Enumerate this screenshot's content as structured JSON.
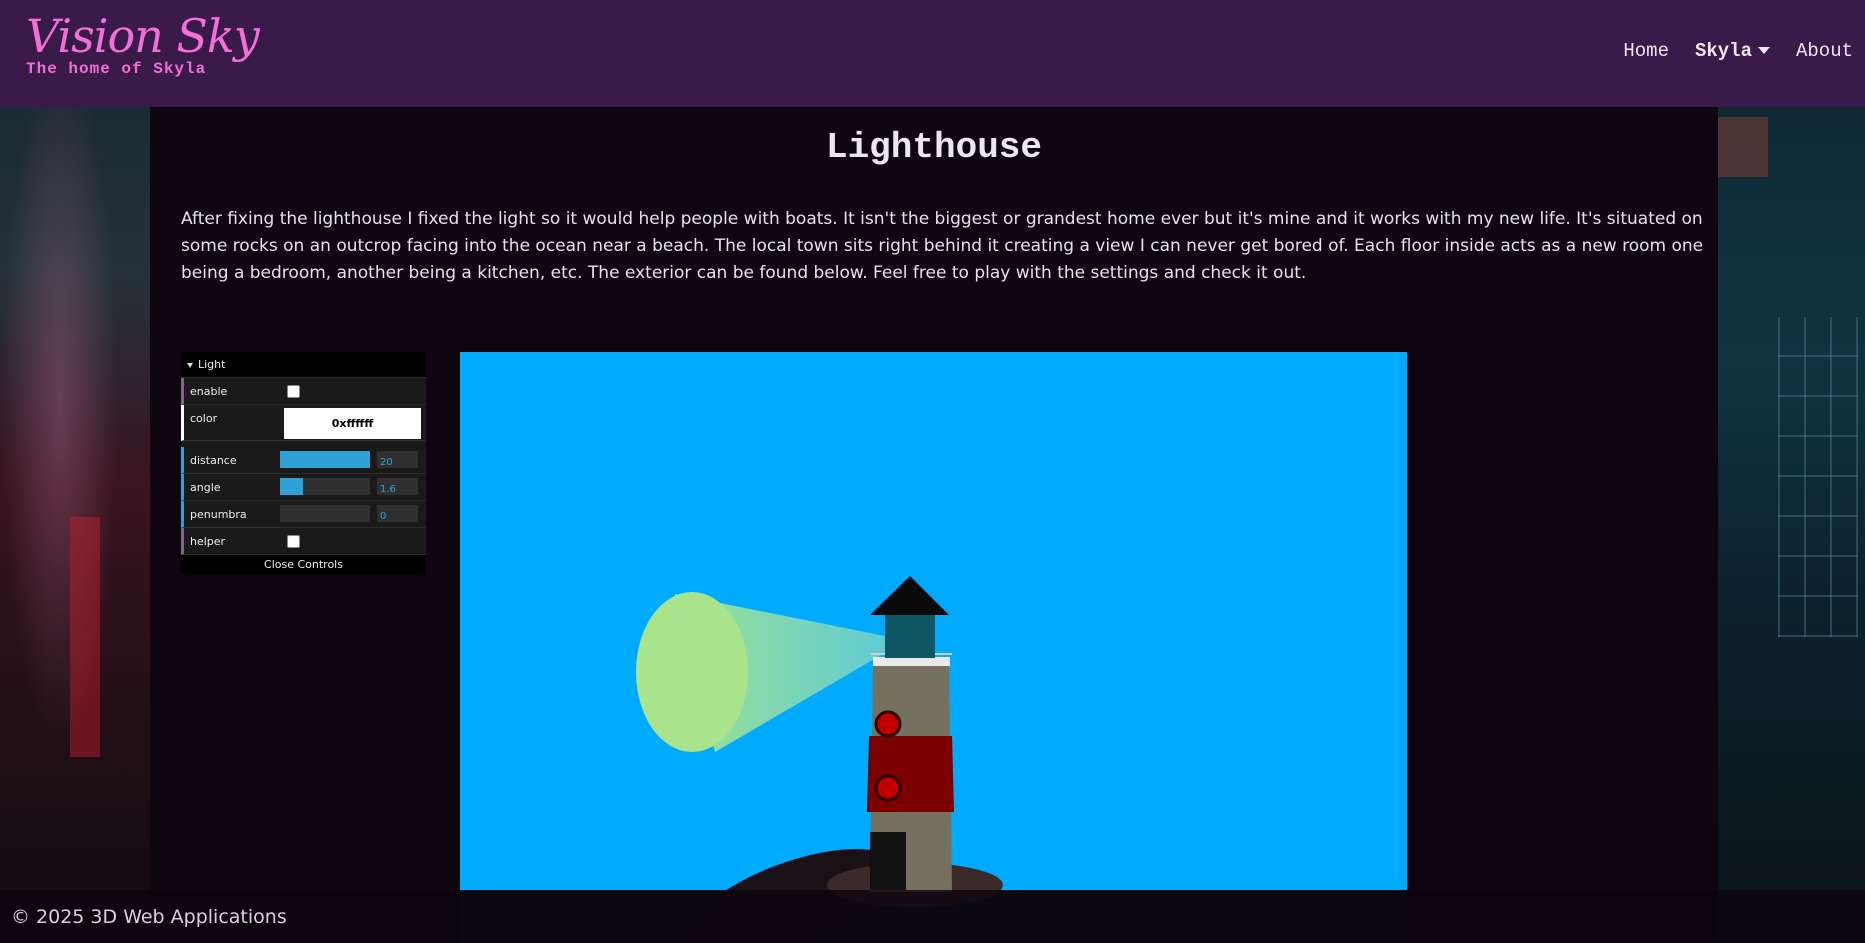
{
  "brand": {
    "title": "Vision Sky",
    "subtitle": "The home of Skyla"
  },
  "nav": {
    "home": "Home",
    "skyla": "Skyla",
    "about": "About"
  },
  "page": {
    "title": "Lighthouse",
    "intro": "After fixing the lighthouse I fixed the light so it would help people with boats. It isn't the biggest or grandest home ever but it's mine and it works with my new life. It's situated on some rocks on an outcrop facing into the ocean near a beach. The local town sits right behind it creating a view I can never get bored of. Each floor inside acts as a new room one being a bedroom, another being a kitchen, etc. The exterior can be found below. Feel free to play with the settings and check it out."
  },
  "gui": {
    "folder": "Light",
    "enable_label": "enable",
    "color_label": "color",
    "color_value": "0xffffff",
    "distance_label": "distance",
    "distance_value": "20",
    "distance_fill": 1.0,
    "angle_label": "angle",
    "angle_value": "1.6",
    "angle_fill": 0.25,
    "penumbra_label": "penumbra",
    "penumbra_value": "0",
    "penumbra_fill": 0.0,
    "helper_label": "helper",
    "close_label": "Close Controls",
    "accent": "#2fa1d6"
  },
  "scene": {
    "sky_color": "#00aaff",
    "ground_color": "#0d1726"
  },
  "footer": {
    "text": "© 2025 3D Web Applications"
  },
  "colors": {
    "nav_bg": "#3a1a48",
    "brand": "#f070d8"
  }
}
